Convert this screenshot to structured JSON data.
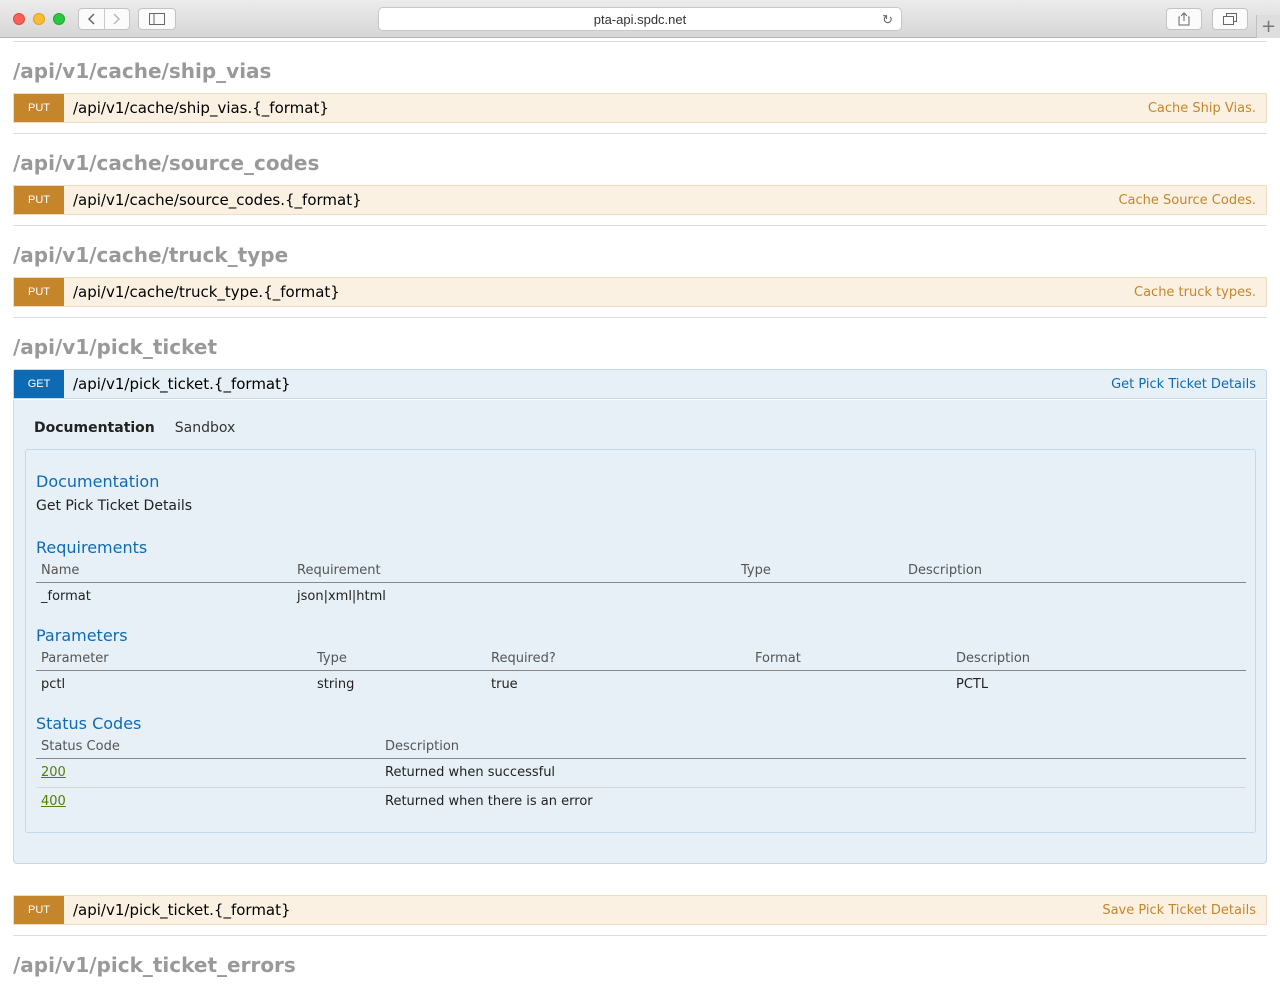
{
  "browser": {
    "url": "pta-api.spdc.net"
  },
  "sections": [
    {
      "title": "/api/v1/cache/ship_vias",
      "op": {
        "method": "PUT",
        "path": "/api/v1/cache/ship_vias.{_format}",
        "summary": "Cache Ship Vias."
      }
    },
    {
      "title": "/api/v1/cache/source_codes",
      "op": {
        "method": "PUT",
        "path": "/api/v1/cache/source_codes.{_format}",
        "summary": "Cache Source Codes."
      }
    },
    {
      "title": "/api/v1/cache/truck_type",
      "op": {
        "method": "PUT",
        "path": "/api/v1/cache/truck_type.{_format}",
        "summary": "Cache truck types."
      }
    },
    {
      "title": "/api/v1/pick_ticket",
      "op": {
        "method": "GET",
        "path": "/api/v1/pick_ticket.{_format}",
        "summary": "Get Pick Ticket Details"
      },
      "op2": {
        "method": "PUT",
        "path": "/api/v1/pick_ticket.{_format}",
        "summary": "Save Pick Ticket Details"
      }
    },
    {
      "title": "/api/v1/pick_ticket_errors"
    }
  ],
  "panel": {
    "tabs": [
      "Documentation",
      "Sandbox"
    ],
    "documentation_heading": "Documentation",
    "documentation_text": "Get Pick Ticket Details",
    "requirements_heading": "Requirements",
    "requirements_columns": [
      "Name",
      "Requirement",
      "Type",
      "Description"
    ],
    "requirements_rows": [
      [
        "_format",
        "json|xml|html",
        "",
        ""
      ]
    ],
    "parameters_heading": "Parameters",
    "parameters_columns": [
      "Parameter",
      "Type",
      "Required?",
      "Format",
      "Description"
    ],
    "parameters_rows": [
      [
        "pctl",
        "string",
        "true",
        "",
        "PCTL"
      ]
    ],
    "status_heading": "Status Codes",
    "status_columns": [
      "Status Code",
      "Description"
    ],
    "status_rows": [
      [
        "200",
        "Returned when successful"
      ],
      [
        "400",
        "Returned when there is an error"
      ]
    ]
  },
  "colors": {
    "put": "#c5862b",
    "get": "#0f6ab4",
    "status_link": "#547f00"
  }
}
